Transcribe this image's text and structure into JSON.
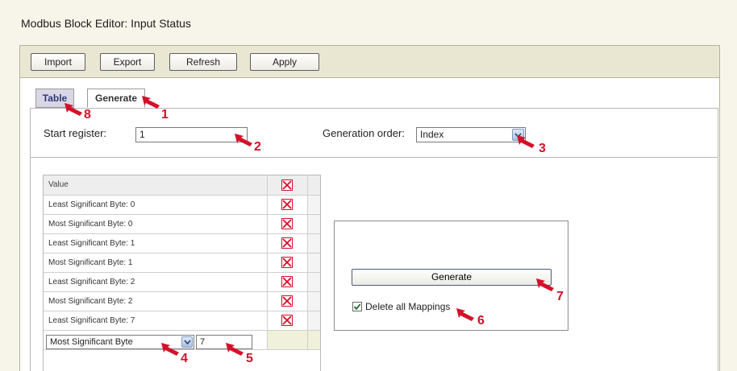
{
  "window": {
    "title": "Modbus Block Editor: Input Status"
  },
  "toolbar": {
    "import_label": "Import",
    "export_label": "Export",
    "refresh_label": "Refresh",
    "apply_label": "Apply"
  },
  "tabs": [
    {
      "label": "Table",
      "active": false
    },
    {
      "label": "Generate",
      "active": true
    }
  ],
  "form": {
    "start_register_label": "Start register:",
    "start_register_value": "1",
    "generation_order_label": "Generation order:",
    "generation_order_value": "Index"
  },
  "table": {
    "column_header": "Value",
    "rows": [
      "Least Significant Byte: 0",
      "Most Significant Byte: 0",
      "Least Significant Byte: 1",
      "Most Significant Byte: 1",
      "Least Significant Byte: 2",
      "Most Significant Byte: 2",
      "Least Significant Byte: 7"
    ],
    "new_row": {
      "byte_select_value": "Most Significant Byte",
      "index_value": "7"
    }
  },
  "generate_panel": {
    "generate_label": "Generate",
    "delete_all_label": "Delete all Mappings",
    "delete_all_checked": true
  },
  "callouts": [
    "1",
    "2",
    "3",
    "4",
    "5",
    "6",
    "7",
    "8"
  ],
  "colors": {
    "callout": "#d4102a",
    "delete_icon": "#d4102a",
    "tab_inactive": "#d9d7e6",
    "toolbar_bg": "#e9e6d2",
    "page_bg": "#f7f5e9"
  },
  "icons": {
    "delete": "delete-x-icon",
    "dropdown": "chevron-down-icon",
    "checkbox": "checkmark-icon",
    "callout_arrow": "arrow-pointer-icon"
  }
}
